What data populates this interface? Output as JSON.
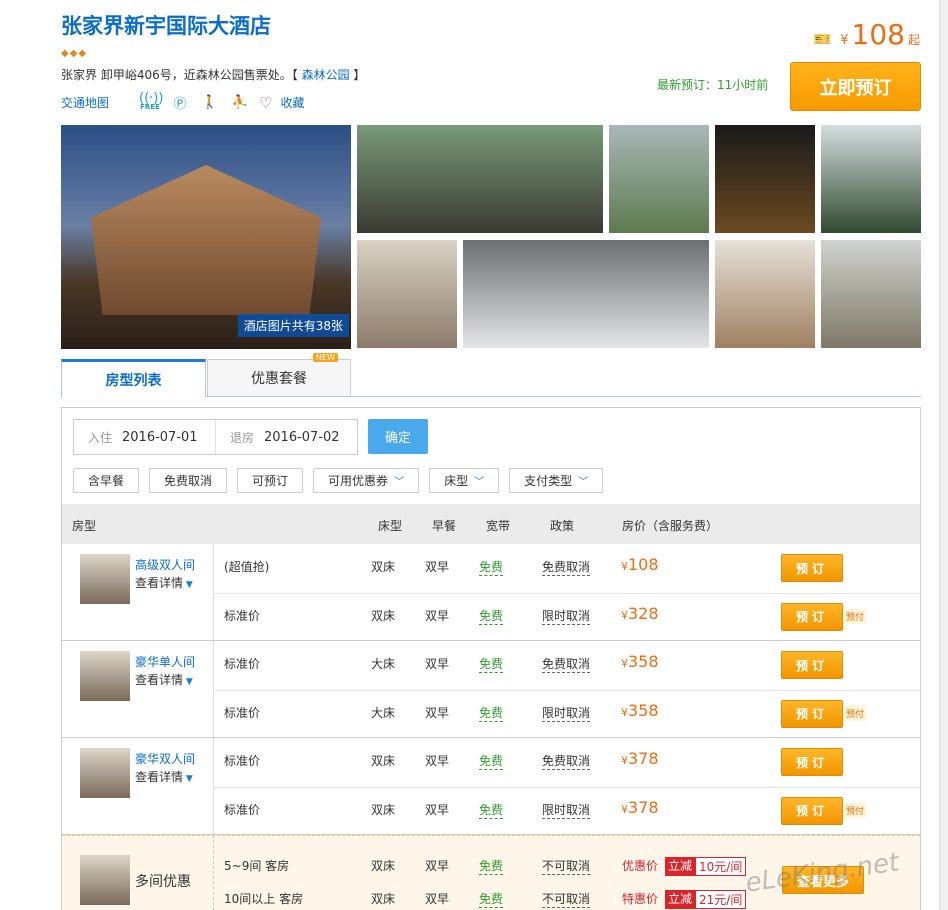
{
  "hotel": {
    "name": "张家界新宇国际大酒店",
    "stars": "◆◆◆",
    "address": "张家界 卸甲峪406号，近森林公园售票处。【",
    "park_link": "森林公园",
    "address_end": "】",
    "map_link": "交通地图",
    "wifi_label": "FREE",
    "favorite": "收藏"
  },
  "price_top": {
    "currency": "¥",
    "value": "108",
    "suffix": "起"
  },
  "recent_booking": "最新预订：11小时前",
  "book_now": "立即预订",
  "photos": {
    "count_label": "酒店图片共有38张"
  },
  "tabs": [
    {
      "label": "房型列表",
      "active": true
    },
    {
      "label": "优惠套餐",
      "badge": "NEW"
    }
  ],
  "search": {
    "checkin_label": "入住",
    "checkin": "2016-07-01",
    "checkout_label": "退房",
    "checkout": "2016-07-02",
    "confirm": "确定"
  },
  "filters": [
    {
      "label": "含早餐"
    },
    {
      "label": "免费取消"
    },
    {
      "label": "可预订"
    },
    {
      "label": "可用优惠券",
      "dropdown": true
    },
    {
      "label": "床型",
      "dropdown": true
    },
    {
      "label": "支付类型",
      "dropdown": true
    }
  ],
  "columns": [
    "房型",
    "床型",
    "早餐",
    "宽带",
    "政策",
    "房价（含服务费）"
  ],
  "room_types": [
    {
      "name": "高级双人间",
      "detail": "查看详情",
      "rates": [
        {
          "plan": "(超值抢)",
          "bed": "双床",
          "breakfast": "双早",
          "internet": "免费",
          "policy": "免费取消",
          "price": "108",
          "book": "预订"
        },
        {
          "plan": "标准价",
          "bed": "双床",
          "breakfast": "双早",
          "internet": "免费",
          "policy": "限时取消",
          "price": "328",
          "book": "预订",
          "prepay": "预付"
        }
      ]
    },
    {
      "name": "豪华单人间",
      "detail": "查看详情",
      "rates": [
        {
          "plan": "标准价",
          "bed": "大床",
          "breakfast": "双早",
          "internet": "免费",
          "policy": "免费取消",
          "price": "358",
          "book": "预订"
        },
        {
          "plan": "标准价",
          "bed": "大床",
          "breakfast": "双早",
          "internet": "免费",
          "policy": "限时取消",
          "price": "358",
          "book": "预订",
          "prepay": "预付"
        }
      ]
    },
    {
      "name": "豪华双人间",
      "detail": "查看详情",
      "rates": [
        {
          "plan": "标准价",
          "bed": "双床",
          "breakfast": "双早",
          "internet": "免费",
          "policy": "免费取消",
          "price": "378",
          "book": "预订"
        },
        {
          "plan": "标准价",
          "bed": "双床",
          "breakfast": "双早",
          "internet": "免费",
          "policy": "限时取消",
          "price": "378",
          "book": "预订",
          "prepay": "预付"
        }
      ]
    }
  ],
  "multi_room": {
    "title": "多间优惠",
    "rates": [
      {
        "plan": "5~9间 客房",
        "bed": "双床",
        "breakfast": "双早",
        "internet": "免费",
        "policy": "不可取消",
        "deal_label": "优惠价",
        "tag": "立减",
        "value": "10元/间"
      },
      {
        "plan": "10间以上 客房",
        "bed": "双床",
        "breakfast": "双早",
        "internet": "免费",
        "policy": "不可取消",
        "deal_label": "特惠价",
        "tag": "立减",
        "value": "21元/间"
      }
    ],
    "more": "查看更多"
  },
  "currency": "¥",
  "watermark": "eLeKing.net"
}
